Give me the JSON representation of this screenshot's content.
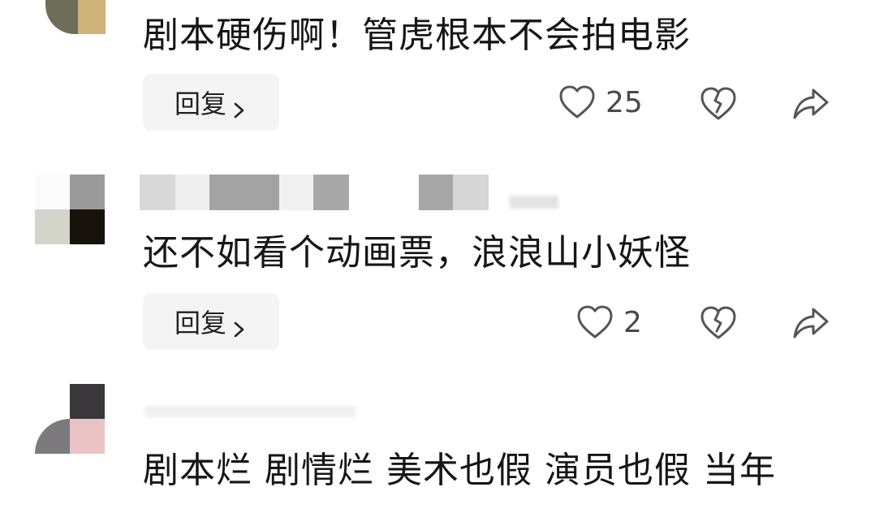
{
  "comments": [
    {
      "text": "剧本硬伤啊！管虎根本不会拍电影",
      "reply_label": "回复",
      "likes": "25",
      "icons": {
        "like": "heart-icon",
        "dislike": "broken-heart-icon",
        "share": "share-icon"
      }
    },
    {
      "text": "还不如看个动画票，浪浪山小妖怪",
      "reply_label": "回复",
      "likes": "2",
      "icons": {
        "like": "heart-icon",
        "dislike": "broken-heart-icon",
        "share": "share-icon"
      }
    },
    {
      "text_line1": "剧本烂 剧情烂 美术也假 演员也假 当年",
      "text_line2": ""
    }
  ],
  "colors": {
    "text": "#161616",
    "reply_bg": "#f4f4f4",
    "icon": "#555555"
  }
}
